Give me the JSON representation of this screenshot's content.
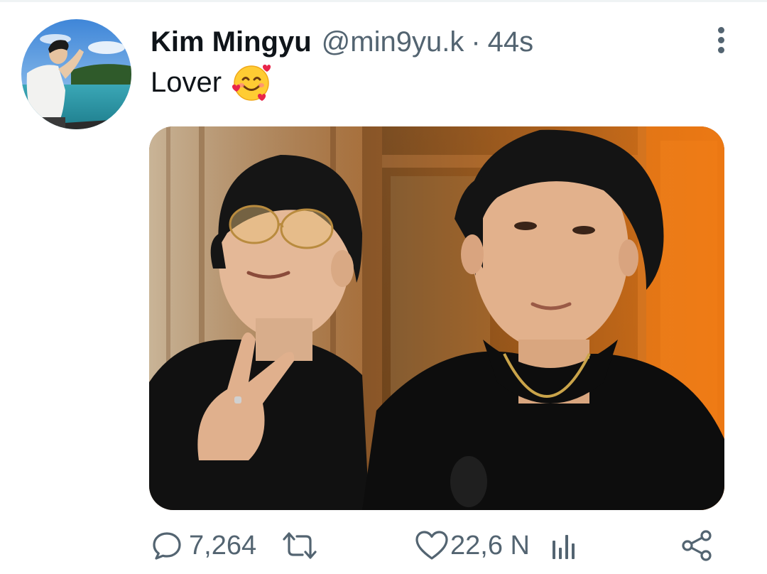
{
  "tweet": {
    "author_name": "Kim Mingyu",
    "handle": "@min9yu.k",
    "separator": "·",
    "timestamp": "44s",
    "text": "Lover",
    "emoji": "smiling-face-with-hearts",
    "avatar": "profile-photo",
    "media": "photo of two young men in black shirts"
  },
  "actions": {
    "replies": "7,264",
    "retweets": "",
    "likes": "22,6 N",
    "views": "",
    "share": ""
  },
  "icons": {
    "reply": "speech-bubble-icon",
    "retweet": "retweet-arrows-icon",
    "like": "heart-icon",
    "views": "bar-chart-icon",
    "share": "share-icon",
    "more": "vertical-dots-icon"
  },
  "colors": {
    "primary_text": "#0f1419",
    "secondary_text": "#536471",
    "background": "#ffffff"
  }
}
